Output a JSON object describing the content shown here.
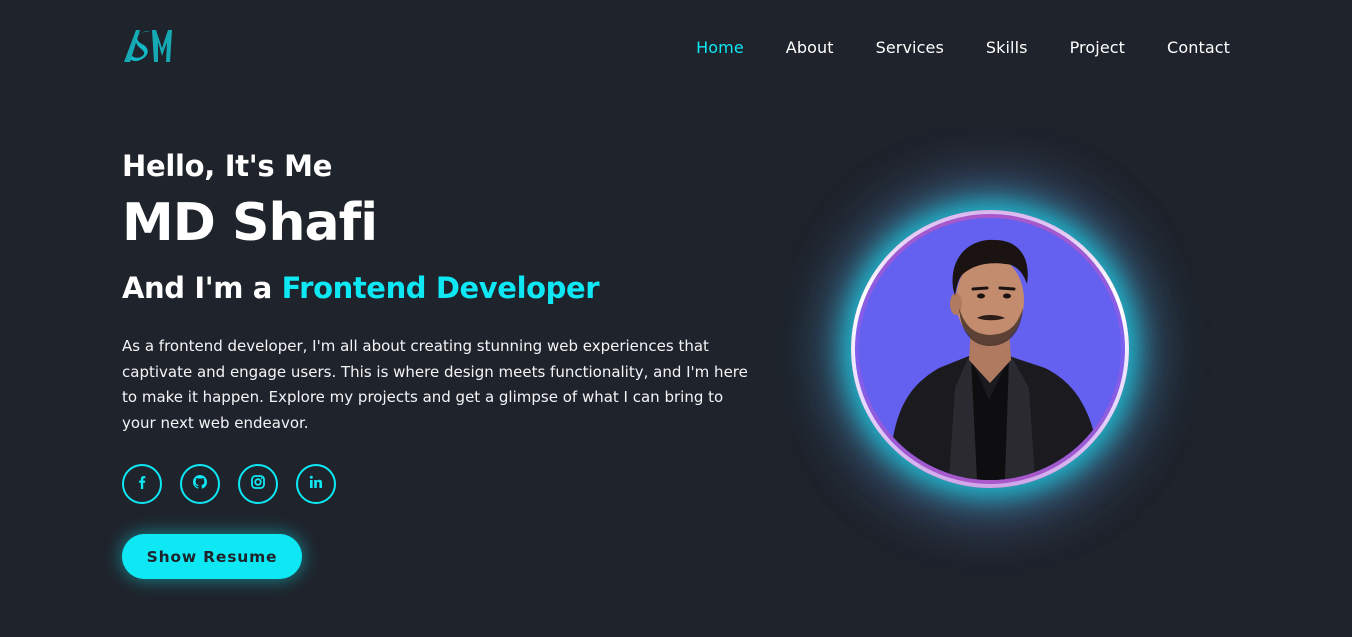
{
  "header": {
    "logo_icon": "sm-monogram-logo",
    "nav": [
      {
        "label": "Home",
        "active": true
      },
      {
        "label": "About",
        "active": false
      },
      {
        "label": "Services",
        "active": false
      },
      {
        "label": "Skills",
        "active": false
      },
      {
        "label": "Project",
        "active": false
      },
      {
        "label": "Contact",
        "active": false
      }
    ]
  },
  "hero": {
    "greeting": "Hello, It's Me",
    "name": "MD Shafi",
    "role_prefix": "And I'm a",
    "role_highlight": "Frontend Developer",
    "description": "As a frontend developer, I'm all about creating stunning web experiences that captivate and engage users. This is where design meets functionality, and I'm here to make it happen. Explore my projects and get a glimpse of what I can bring to your next web endeavor.",
    "socials": [
      {
        "icon": "facebook-icon"
      },
      {
        "icon": "github-icon"
      },
      {
        "icon": "instagram-icon"
      },
      {
        "icon": "linkedin-icon"
      }
    ],
    "resume_button": "Show Resume"
  },
  "colors": {
    "background": "#1f232b",
    "accent": "#0ee8f5",
    "avatar_bg": "#6461f1"
  }
}
